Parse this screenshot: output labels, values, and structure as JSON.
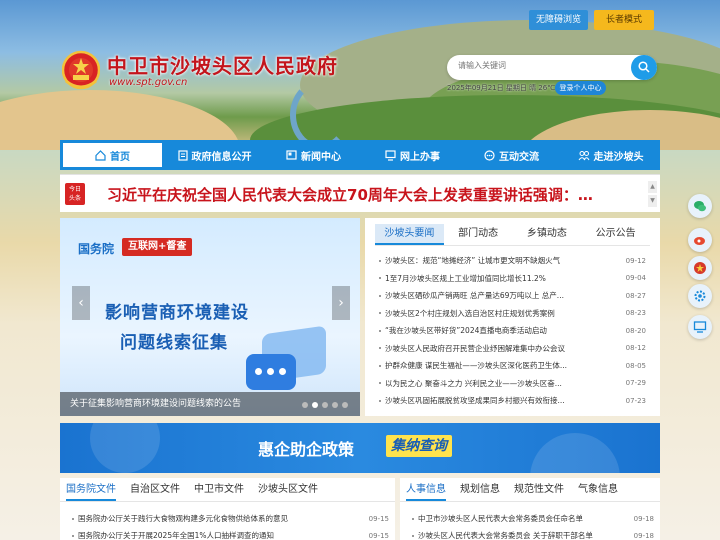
{
  "header": {
    "accessibility_label": "无障碍浏览",
    "elder_label": "长者模式",
    "site_title": "中卫市沙坡头区人民政府",
    "site_url": "www.spt.gov.cn",
    "search_placeholder": "请输入关键词",
    "date_text": "2025年09月21日  星期日  晴 26℃",
    "login_label": "登录个人中心"
  },
  "nav": {
    "items": [
      {
        "label": "首页",
        "icon": "home-icon"
      },
      {
        "label": "政府信息公开",
        "icon": "document-icon"
      },
      {
        "label": "新闻中心",
        "icon": "news-icon"
      },
      {
        "label": "网上办事",
        "icon": "monitor-icon"
      },
      {
        "label": "互动交流",
        "icon": "chat-icon"
      },
      {
        "label": "走进沙坡头",
        "icon": "people-icon"
      }
    ]
  },
  "headline": {
    "badge_top": "今日",
    "badge_bottom": "头条",
    "text": "习近平在庆祝全国人民代表大会成立70周年大会上发表重要讲话强调：…"
  },
  "carousel": {
    "org": "国务院",
    "tag": "互联网+督查",
    "line1": "影响营商环境建设",
    "line2": "问题线索征集",
    "caption": "关于征集影响营商环境建设问题线索的公告"
  },
  "news": {
    "tabs": [
      "沙坡头要闻",
      "部门动态",
      "乡镇动态",
      "公示公告"
    ],
    "rows": [
      {
        "title": "沙坡头区：规范“地摊经济” 让城市更文明不缺烟火气",
        "date": "09-12"
      },
      {
        "title": "1至7月沙坡头区规上工业增加值同比增长11.2%",
        "date": "09-04"
      },
      {
        "title": "沙坡头区硒砂瓜产销两旺 总产量达69万吨以上 总产...",
        "date": "08-27"
      },
      {
        "title": "沙坡头区2个村庄规划入选自治区村庄规划优秀案例",
        "date": "08-23"
      },
      {
        "title": "“我在沙坡头区带好货”2024直播电商季活动启动",
        "date": "08-20"
      },
      {
        "title": "沙坡头区人民政府召开民营企业纾困解难集中办公会议",
        "date": "08-12"
      },
      {
        "title": "护群众健康 谋民生福祉——沙坡头区深化医药卫生体...",
        "date": "08-05"
      },
      {
        "title": "以为民之心 聚奋斗之力 兴利民之业——沙坡头区奋...",
        "date": "07-29"
      },
      {
        "title": "沙坡头区巩固拓展脱贫攻坚成果同乡村振兴有效衔接...",
        "date": "07-23"
      }
    ]
  },
  "promo": {
    "text": "惠企助企政策",
    "tag": "集纳查询"
  },
  "files": {
    "tabs": [
      "国务院文件",
      "自治区文件",
      "中卫市文件",
      "沙坡头区文件"
    ],
    "rows": [
      {
        "title": "国务院办公厅关于践行大食物观构建多元化食物供给体系的意见",
        "date": "09-15"
      },
      {
        "title": "国务院办公厅关于开展2025年全国1%人口抽样调查的通知",
        "date": "09-15"
      }
    ]
  },
  "info": {
    "tabs": [
      "人事信息",
      "规划信息",
      "规范性文件",
      "气象信息"
    ],
    "rows": [
      {
        "title": "中卫市沙坡头区人民代表大会常务委员会任命名单",
        "date": "09-18"
      },
      {
        "title": "沙坡头区人民代表大会常务委员会 关于辞职干部名单",
        "date": "09-18"
      }
    ]
  },
  "colors": {
    "primary": "#1789da",
    "title_red": "#c3151c",
    "elder_yellow": "#f5b81d"
  }
}
